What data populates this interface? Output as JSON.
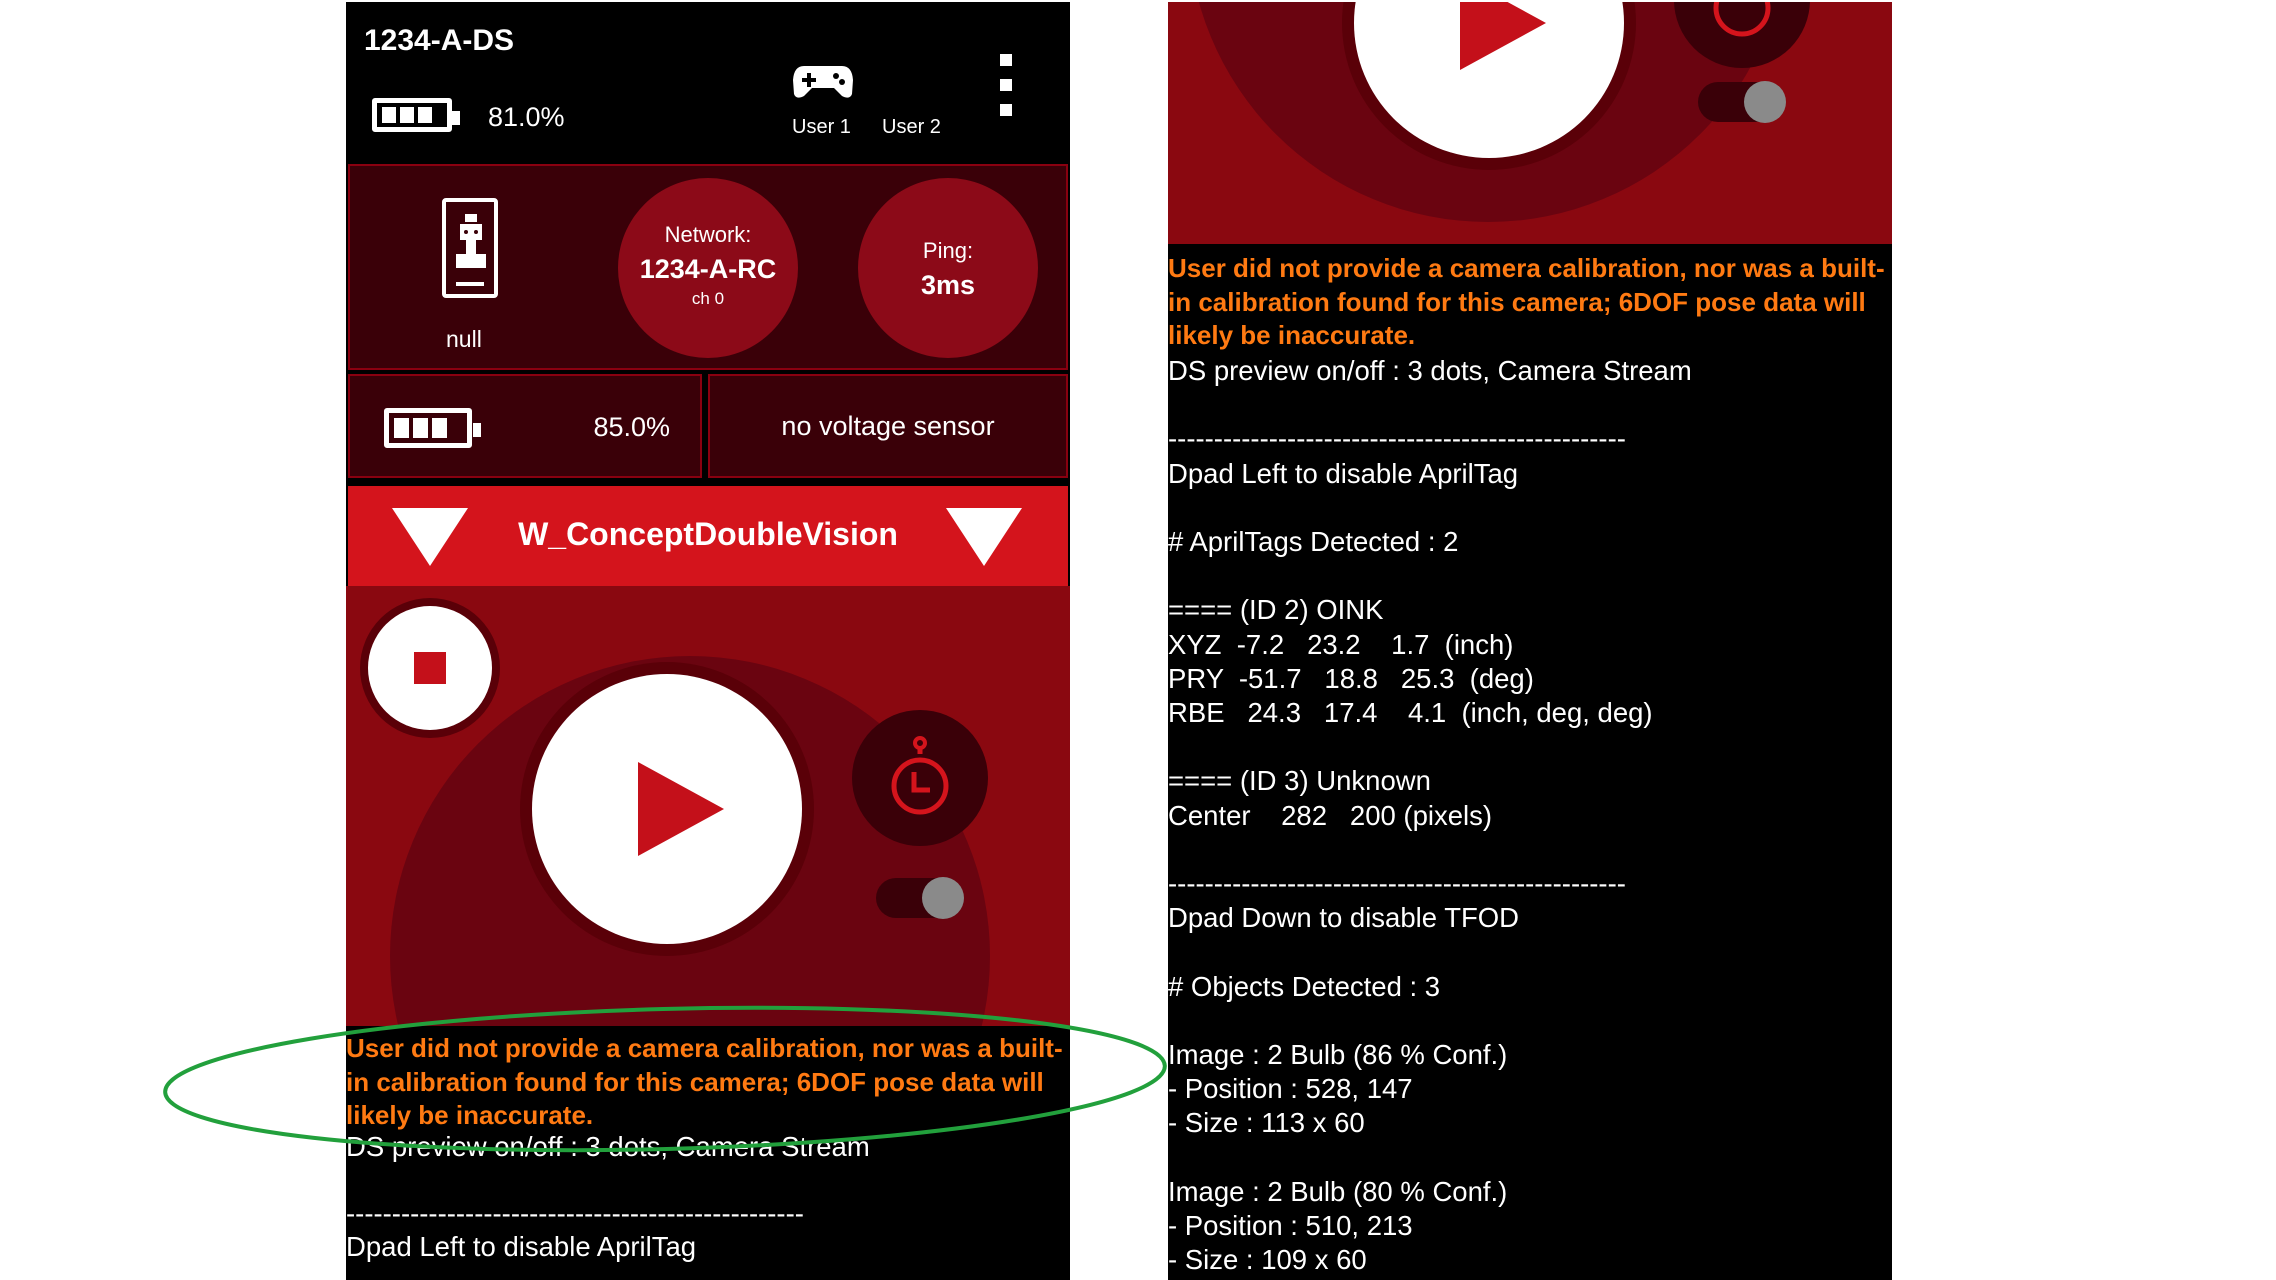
{
  "status": {
    "robot_name": "1234-A-DS",
    "battery": "81.0%",
    "user1": "User 1",
    "user2": "User 2"
  },
  "info": {
    "robot_label": "null",
    "network_title": "Network:",
    "network_name": "1234-A-RC",
    "network_channel": "ch 0",
    "ping_title": "Ping:",
    "ping_value": "3ms"
  },
  "robot_battery": {
    "value": "85.0%",
    "voltage": "no voltage sensor"
  },
  "opmode": {
    "name": "W_ConceptDoubleVision"
  },
  "telemetry": {
    "warning": "User did not provide a camera calibration, nor was a built-in calibration found for this camera; 6DOF pose data will likely be inaccurate.",
    "lines": [
      "DS preview on/off : 3 dots, Camera Stream",
      "",
      "--------------------------------------------------",
      "Dpad Left to disable AprilTag",
      "",
      "# AprilTags Detected : 2",
      "",
      "==== (ID 2) OINK",
      "XYZ  -7.2   23.2    1.7  (inch)",
      "PRY  -51.7   18.8   25.3  (deg)",
      "RBE   24.3   17.4    4.1  (inch, deg, deg)",
      "",
      "==== (ID 3) Unknown",
      "Center    282   200 (pixels)",
      "",
      "--------------------------------------------------",
      "Dpad Down to disable TFOD",
      "",
      "# Objects Detected : 3",
      "",
      "Image : 2 Bulb (86 % Conf.)",
      "- Position : 528, 147",
      "- Size : 113 x 60",
      "",
      "Image : 2 Bulb (80 % Conf.)",
      "- Position : 510, 213",
      "- Size : 109 x 60"
    ]
  },
  "colors": {
    "accent_red": "#d4141c",
    "warning_orange": "#ff7a12",
    "annotation_green": "#22a03c"
  }
}
